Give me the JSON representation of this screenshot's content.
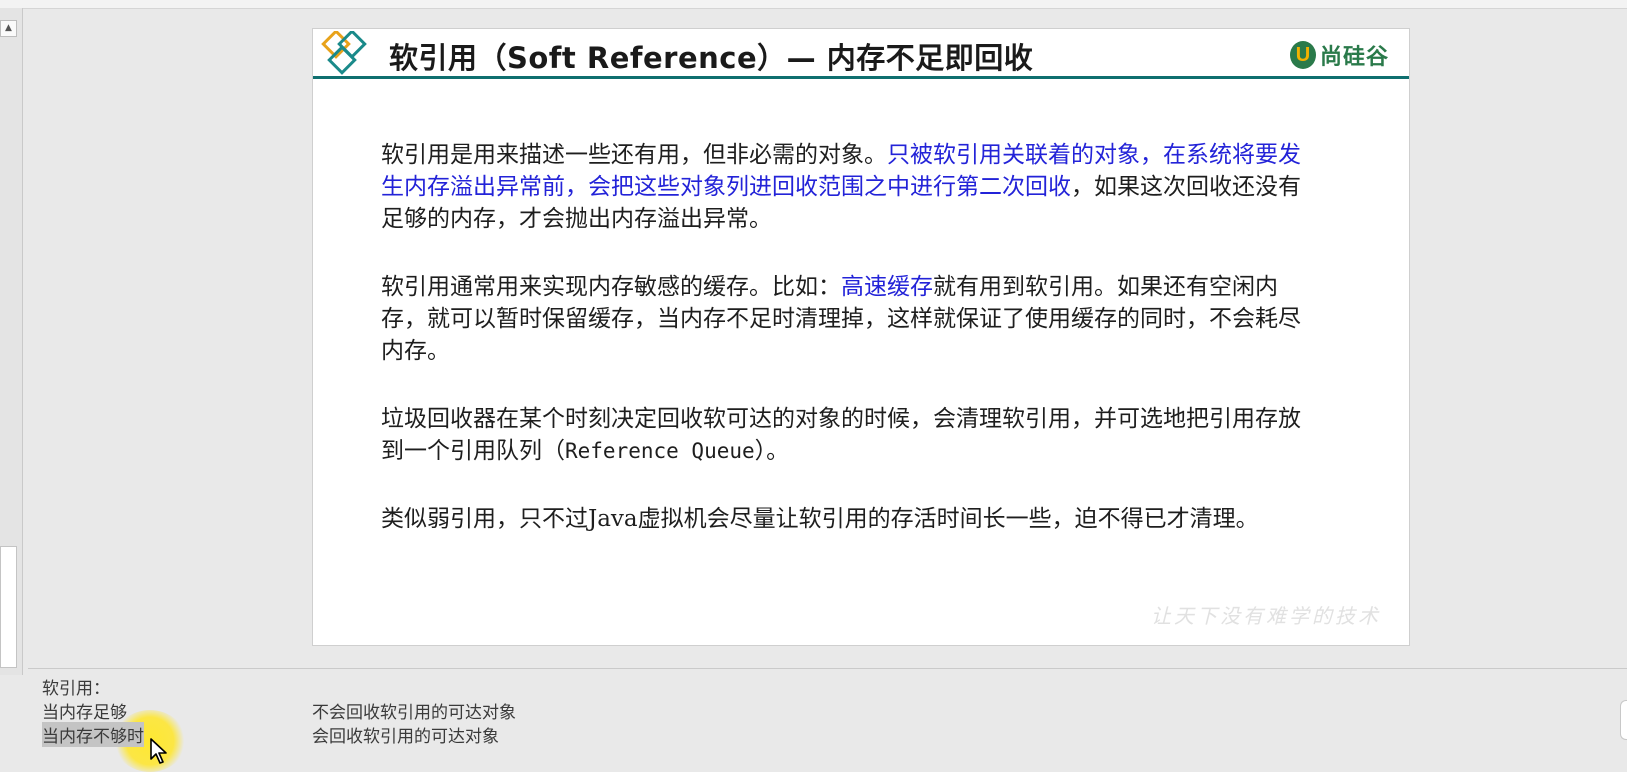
{
  "slide": {
    "title": "软引用（Soft Reference）— 内存不足即回收",
    "brand": {
      "mark": "U",
      "name": "尚硅谷"
    },
    "paragraphs": [
      {
        "segments": [
          {
            "text": "软引用是用来描述一些还有用，但非必需的对象。",
            "highlight": false
          },
          {
            "text": "只被软引用关联着的对象，在系统将要发生内存溢出异常前，会把这些对象列进回收范围之中进行第二次回收",
            "highlight": true
          },
          {
            "text": "，如果这次回收还没有足够的内存，才会抛出内存溢出异常。",
            "highlight": false
          }
        ]
      },
      {
        "segments": [
          {
            "text": "软引用通常用来实现内存敏感的缓存。比如：",
            "highlight": false
          },
          {
            "text": "高速缓存",
            "highlight": true
          },
          {
            "text": "就有用到软引用。如果还有空闲内存，就可以暂时保留缓存，当内存不足时清理掉，这样就保证了使用缓存的同时，不会耗尽内存。",
            "highlight": false
          }
        ]
      },
      {
        "segments": [
          {
            "text": "垃圾回收器在某个时刻决定回收软可达的对象的时候，会清理软引用，并可选地把引用存放到一个引用队列（",
            "highlight": false
          },
          {
            "text": "Reference Queue",
            "highlight": false,
            "mono": true
          },
          {
            "text": "）。",
            "highlight": false
          }
        ]
      },
      {
        "segments": [
          {
            "text": "类似弱引用，只不过Java虚拟机会尽量让软引用的存活时间长一些，迫不得已才清理。",
            "highlight": false
          }
        ]
      }
    ],
    "watermark": "让天下没有难学的技术"
  },
  "notes": {
    "heading": "软引用：",
    "rows": [
      {
        "condition": "当内存足够",
        "result": "不会回收软引用的可达对象"
      },
      {
        "condition": "当内存不够时",
        "result": "会回收软引用的可达对象"
      }
    ]
  },
  "colors": {
    "highlight": "#2323d8",
    "header_rule": "#0f6f6f",
    "brand_green": "#2a7a4a",
    "brand_yellow": "#f2b200",
    "cursor_glow": "#ffe828"
  },
  "icons": [
    "diamond-logo-icon",
    "scroll-up-arrow-icon",
    "mouse-pointer-icon"
  ]
}
